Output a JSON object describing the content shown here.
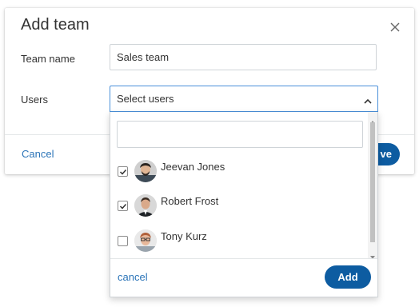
{
  "modal": {
    "title": "Add team",
    "team_name_label": "Team name",
    "team_name_value": "Sales team",
    "users_label": "Users",
    "cancel_label": "Cancel",
    "save_label": "ve"
  },
  "select": {
    "placeholder": "Select users",
    "expanded": true
  },
  "dropdown": {
    "search_value": "",
    "users": [
      {
        "name": "Jeevan Jones",
        "checked": true
      },
      {
        "name": "Robert Frost",
        "checked": true
      },
      {
        "name": "Tony Kurz",
        "checked": false
      }
    ],
    "cancel_label": "cancel",
    "add_label": "Add"
  },
  "colors": {
    "primary_button": "#0d5ca1",
    "link": "#2b74b8",
    "focus_border": "#4a90d9"
  },
  "icons": {
    "close": "close-icon",
    "chevron": "chevron-up-icon",
    "check": "checkmark-icon"
  }
}
